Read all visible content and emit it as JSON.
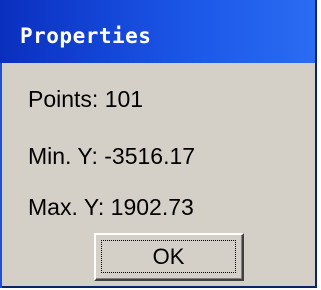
{
  "dialog": {
    "title": "Properties",
    "points_line": "Points: 101",
    "min_y_line": "Min. Y: -3516.17",
    "max_y_line": "Max. Y: 1902.73",
    "ok_label": "OK"
  },
  "colors": {
    "title_bar": "#1c57e8",
    "dialog_face": "#d4d0c8",
    "title_text": "#ffffff"
  }
}
